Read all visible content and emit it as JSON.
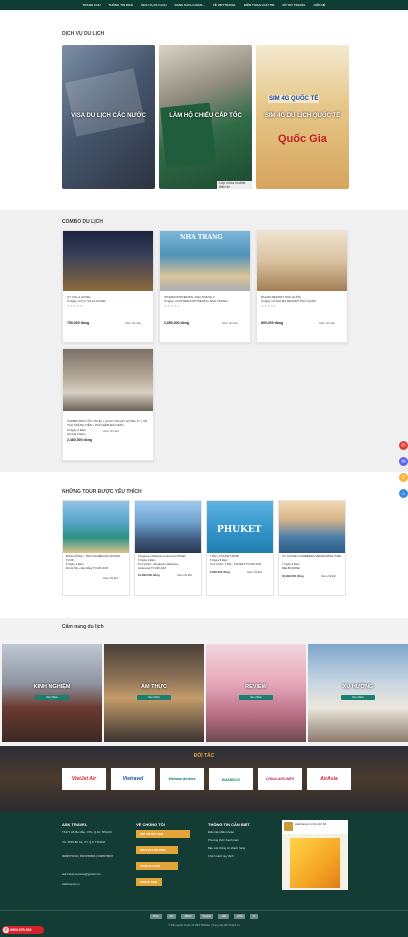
{
  "nav": {
    "items": [
      "TRANG CHỦ",
      "THÔNG TIN DỊCH",
      "DỊCH VỤ DU LỊCH",
      "DANH SÁCH HOÀN...",
      "VỀ VIETTRAVEL",
      "ĐIỆN THOẠI CHỦ TIN",
      "SỔ TAY TRAVEL",
      "LIÊN HỆ"
    ]
  },
  "services": {
    "title": "Dịch vụ du lịch",
    "items": [
      {
        "label": "VISA DU LỊCH CÁC NƯỚC",
        "color": "#5a6f8a"
      },
      {
        "label": "LÀM HỘ CHIẾU CẤP TỐC",
        "color": "#4f8a62",
        "overlay": "Lớp chứa mobile điện từ"
      },
      {
        "label": "SIM 4G DU LỊCH QUỐC TẾ",
        "color": "#c9a860",
        "sim_text": "SIM 4G QUỐC TẾ",
        "sim_sub": "Quốc Gia"
      }
    ]
  },
  "combo": {
    "title": "Combo du lịch",
    "items": [
      {
        "title": "UY VILLA HOTEL",
        "sub": "3 Ngày với UY VILLA HOTEL",
        "price": "750,000 đồng",
        "more": "Xem chi tiết",
        "img": "city-night"
      },
      {
        "title": "INTERCONTINENTAL NHA TRANG 3",
        "sub": "3 Ngày với INTERCONTINENTAL NHA TRANG...",
        "price": "2,850,000 đồng",
        "more": "Xem chi tiết",
        "img": "beach",
        "banner": "NHA TRANG"
      },
      {
        "title": "PALMA RESORT PHÚ QUỐC",
        "sub": "3 Ngày với PALMA RESORT PHÚ QUỐC",
        "price": "800,000 đồng",
        "more": "Xem chi tiết",
        "img": "room"
      },
      {
        "title": "COMBO BẢO LỘC TOUR + GOLF VALLEY HOTEL 3* + VÉ TÀU TRÀNG TIỀN + PHỐ ĐÊM ĐẠO BẢN",
        "sub": "3 Ngày 2 Đêm",
        "sub2": "Hà Nội 2 Đêm",
        "price": "2,480,000 đồng",
        "more": "Xem chi tiết",
        "img": "bedroom"
      }
    ]
  },
  "tours": {
    "title": "Những tour được yêu thích",
    "items": [
      {
        "title": "ĐÌNH HỨNG + TRẢI NGHIỆM ĐỒ HOSTEL TOUR",
        "lines": [
          "5 Ngày 4 Đêm",
          "Đi Hà Nội + Đà Nẵng TOUR HCM"
        ],
        "price": "",
        "more": "Xem chi tiết"
      },
      {
        "title": "Singapore-Malaysia-Indonesia (5N4Đ)",
        "lines": [
          "5 Ngày 4 Đêm",
          "Tour HCM - Singapore Malaysia -",
          "Indonesia TOUR HCM"
        ],
        "price": "10,990,000 đồng",
        "more": "Xem chi tiết"
      },
      {
        "title": "THÁI + PHUKET 6N5Đ",
        "lines": [
          "6 Ngày 5 Đêm",
          "Tour HCM - THÁI - PHUKET TOUR HCM"
        ],
        "price": "5,990,000 đồng",
        "more": "Xem chi tiết",
        "banner": "PHUKET"
      },
      {
        "title": "ÚC SYDNEY-CANBERRA-MELBOURNE 7N6Đ",
        "lines": [
          "7 Ngày 6 Đêm",
          "MELBOURNE"
        ],
        "price": "40,990,000 đồng",
        "more": "Xem chi tiết"
      }
    ]
  },
  "handbook": {
    "title": "Cẩm nang du lịch",
    "items": [
      {
        "label": "KINH NGHIỆM",
        "btn": "Xem thêm"
      },
      {
        "label": "ẨM THỰC",
        "btn": "Xem thêm"
      },
      {
        "label": "REVIEW",
        "btn": "Xem thêm"
      },
      {
        "label": "XU HƯỚNG",
        "btn": "Xem thêm"
      }
    ]
  },
  "partners": {
    "title": "ĐỐI TÁC",
    "items": [
      {
        "name": "VietJet Air",
        "color": "#d8202a"
      },
      {
        "name": "Vietravel",
        "color": "#1a4d9c"
      },
      {
        "name": "Vietnam Airlines",
        "color": "#0b6f78"
      },
      {
        "name": "BAMBOO",
        "color": "#1c8c5b"
      },
      {
        "name": "CHINA AIRLINES",
        "color": "#b22b4d"
      },
      {
        "name": "AirAsia",
        "color": "#d62430"
      }
    ]
  },
  "footer": {
    "company": {
      "title": "ASK TRAVEL",
      "lines": [
        "TS171 Hồ Ba Mẫu, CTG, Q.10, TPHCM",
        "VG: 3876 Bờ Kè, CT, Q.5, TPHCM",
        "0909575010 | 0907258966 | 0938475007",
        "ask.travel.services@gmail.com",
        "Askfrsarvel.vn"
      ]
    },
    "about": {
      "title": "VỀ CHÚNG TÔI",
      "buttons": [
        "ĐẶT VÉ MÁY BAY",
        "DỊCH VỤ LÀM VISA",
        "TOUR DU LỊCH",
        "KHÁCH SẠN"
      ]
    },
    "info": {
      "title": "THÔNG TIN CẦN BIẾT",
      "links": [
        "Điều kiện điều khoản",
        "Phương thức thanh toán",
        "Bảo mật thông tin khách hàng",
        "Chính sách quy định"
      ]
    },
    "badge": "Askfrsarvel.vn Du lịch Số",
    "payments": [
      "VISA",
      "MC",
      "AMEX",
      "PayPal",
      "JCB",
      "ATM",
      "D"
    ],
    "copyright": "© Bản quyền thuộc về VIETTRAVEL | Cung cấp bởi Nhanh.vn"
  },
  "hotline": "0903.575.010",
  "colors": {
    "dark": "#0e3b34",
    "accent": "#e3a43a",
    "footer": "#133c34"
  }
}
